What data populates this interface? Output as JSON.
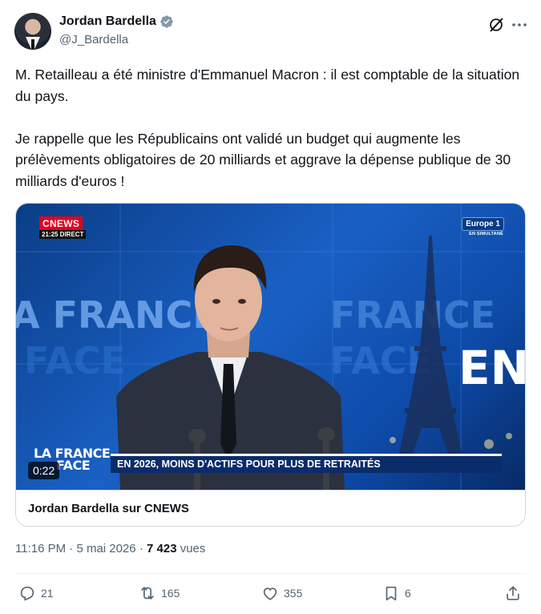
{
  "author": {
    "name": "Jordan Bardella",
    "handle": "@J_Bardella",
    "avatar_icon": "avatar-photo",
    "verified_icon": "verified-badge-icon",
    "verified_color": "#829aab"
  },
  "tweet": {
    "paragraphs": [
      "M. Retailleau a été ministre d'Emmanuel Macron : il est comptable de la situation du pays.",
      "Je rappelle que les Républicains ont validé un budget qui augmente les prélèvements obligatoires de 20 milliards et aggrave la dépense publique de 30 milliards d'euros !"
    ]
  },
  "media": {
    "channel_logo": "CNEWS",
    "channel_time": "21:25 DIRECT",
    "partner_logo": "Europe 1",
    "partner_sub": "EN SIMULTANÉ",
    "show_logo_line1": "LA FRANCE",
    "show_logo_line2": "FACE",
    "banner": "EN 2026, MOINS D'ACTIFS POUR PLUS DE RETRAITÉS",
    "timer": "0:22",
    "caption": "Jordan Bardella sur CNEWS",
    "background_words": [
      "A FRANCE",
      "FRANCE",
      "FACE",
      "FACE",
      "EN"
    ]
  },
  "meta": {
    "time": "11:16 PM",
    "separator": "·",
    "date": "5 mai 2026",
    "views": "7 423",
    "views_label": "vues"
  },
  "actions": {
    "replies": "21",
    "reposts": "165",
    "likes": "355",
    "bookmarks": "6"
  },
  "colors": {
    "text_primary": "#0f1419",
    "text_secondary": "#536471",
    "border": "#cfd9de",
    "video_blue": "#1a60c4"
  }
}
